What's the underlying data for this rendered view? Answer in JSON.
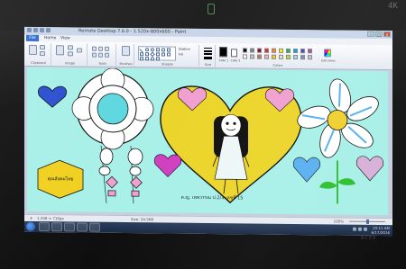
{
  "window": {
    "title": "Remote Desktop 7.6.0 - 1.520x-800x600 - Paint",
    "buttons": [
      "–",
      "□",
      "✕"
    ]
  },
  "menubar": {
    "file": "File",
    "tabs": [
      "Home",
      "View"
    ]
  },
  "ribbon": {
    "groups": [
      {
        "name": "clipboard",
        "label": "Clipboard"
      },
      {
        "name": "image",
        "label": "Image"
      },
      {
        "name": "tools",
        "label": "Tools"
      },
      {
        "name": "brushes",
        "label": "Brushes"
      },
      {
        "name": "shapes",
        "label": "Shapes"
      },
      {
        "name": "size",
        "label": "Size"
      },
      {
        "name": "colors",
        "label": "Colors"
      }
    ],
    "outline_label": "Outline",
    "fill_label": "Fill",
    "color1_label": "Color 1",
    "color2_label": "Color 2",
    "edit_colors_label": "Edit colors",
    "palette": [
      "#000000",
      "#7f7f7f",
      "#880015",
      "#ed1c24",
      "#ff7f27",
      "#fff200",
      "#22b14c",
      "#00a2e8",
      "#3f48cc",
      "#a349a4",
      "#ffffff",
      "#c3c3c3",
      "#b97a57",
      "#ffaec9",
      "#ffc90e",
      "#efe4b0",
      "#b5e61d",
      "#99d9ea",
      "#7092be",
      "#c8bfe7"
    ],
    "color1": "#000000",
    "color2": "#ffffff"
  },
  "canvas": {
    "background": "#a8f0e8",
    "label_box_text": "คุณสังคมไทย",
    "caption": "ด.ญ. เทพวรรณ  ป.2/3 เลขที่ 15",
    "accent": {
      "heart_yellow": "#ecd52a",
      "heart_blue": "#2b4fd0",
      "heart_pink": "#f0a0d0",
      "heart_magenta": "#d040c0",
      "heart_sky": "#58b0f0",
      "heart_lilac": "#d8b0d8",
      "ring_cyan": "#5fd8e0",
      "flower_center": "#f0d030",
      "stem_green": "#30c030",
      "pentagon_yellow": "#f0d020"
    }
  },
  "status": {
    "position": "1,338 × 710px",
    "size": "Size: 24.5KB",
    "zoom": "100%"
  },
  "taskbar": {
    "time": "10:11 AM",
    "date": "6/17/2016"
  },
  "bezel": {
    "brand": "4K",
    "bottom_label": "ACER"
  }
}
